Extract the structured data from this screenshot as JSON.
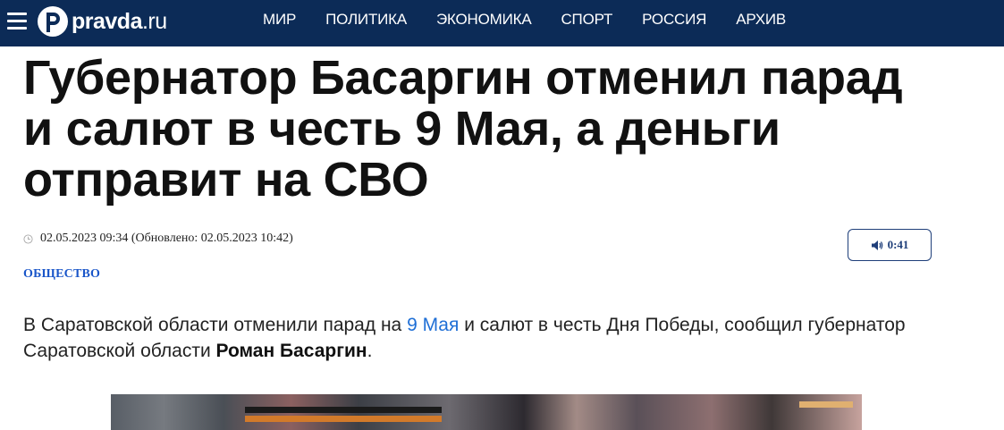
{
  "header": {
    "logo_text": "pravda",
    "logo_suffix": ".ru",
    "nav": [
      "МИР",
      "ПОЛИТИКА",
      "ЭКОНОМИКА",
      "СПОРТ",
      "РОССИЯ",
      "АРХИВ"
    ]
  },
  "article": {
    "title": "Губернатор Басаргин отменил парад и салют в честь 9 Мая, а деньги отправит на СВО",
    "date": "02.05.2023 09:34 (Обновлено: 02.05.2023 10:42)",
    "audio_duration": "0:41",
    "category": "ОБЩЕСТВО",
    "lead": {
      "part1": "В Саратовской области отменили парад на ",
      "link": "9 Мая",
      "part2": " и салют в честь Дня Победы, сообщил губернатор Саратовской области ",
      "bold": "Роман Басаргин",
      "part3": "."
    }
  },
  "colors": {
    "header_bg": "#0c2b57",
    "link": "#1f6fd6",
    "category": "#1a56c9"
  },
  "icons": {
    "menu": "menu-icon",
    "clock": "clock-icon",
    "speaker": "speaker-icon"
  }
}
